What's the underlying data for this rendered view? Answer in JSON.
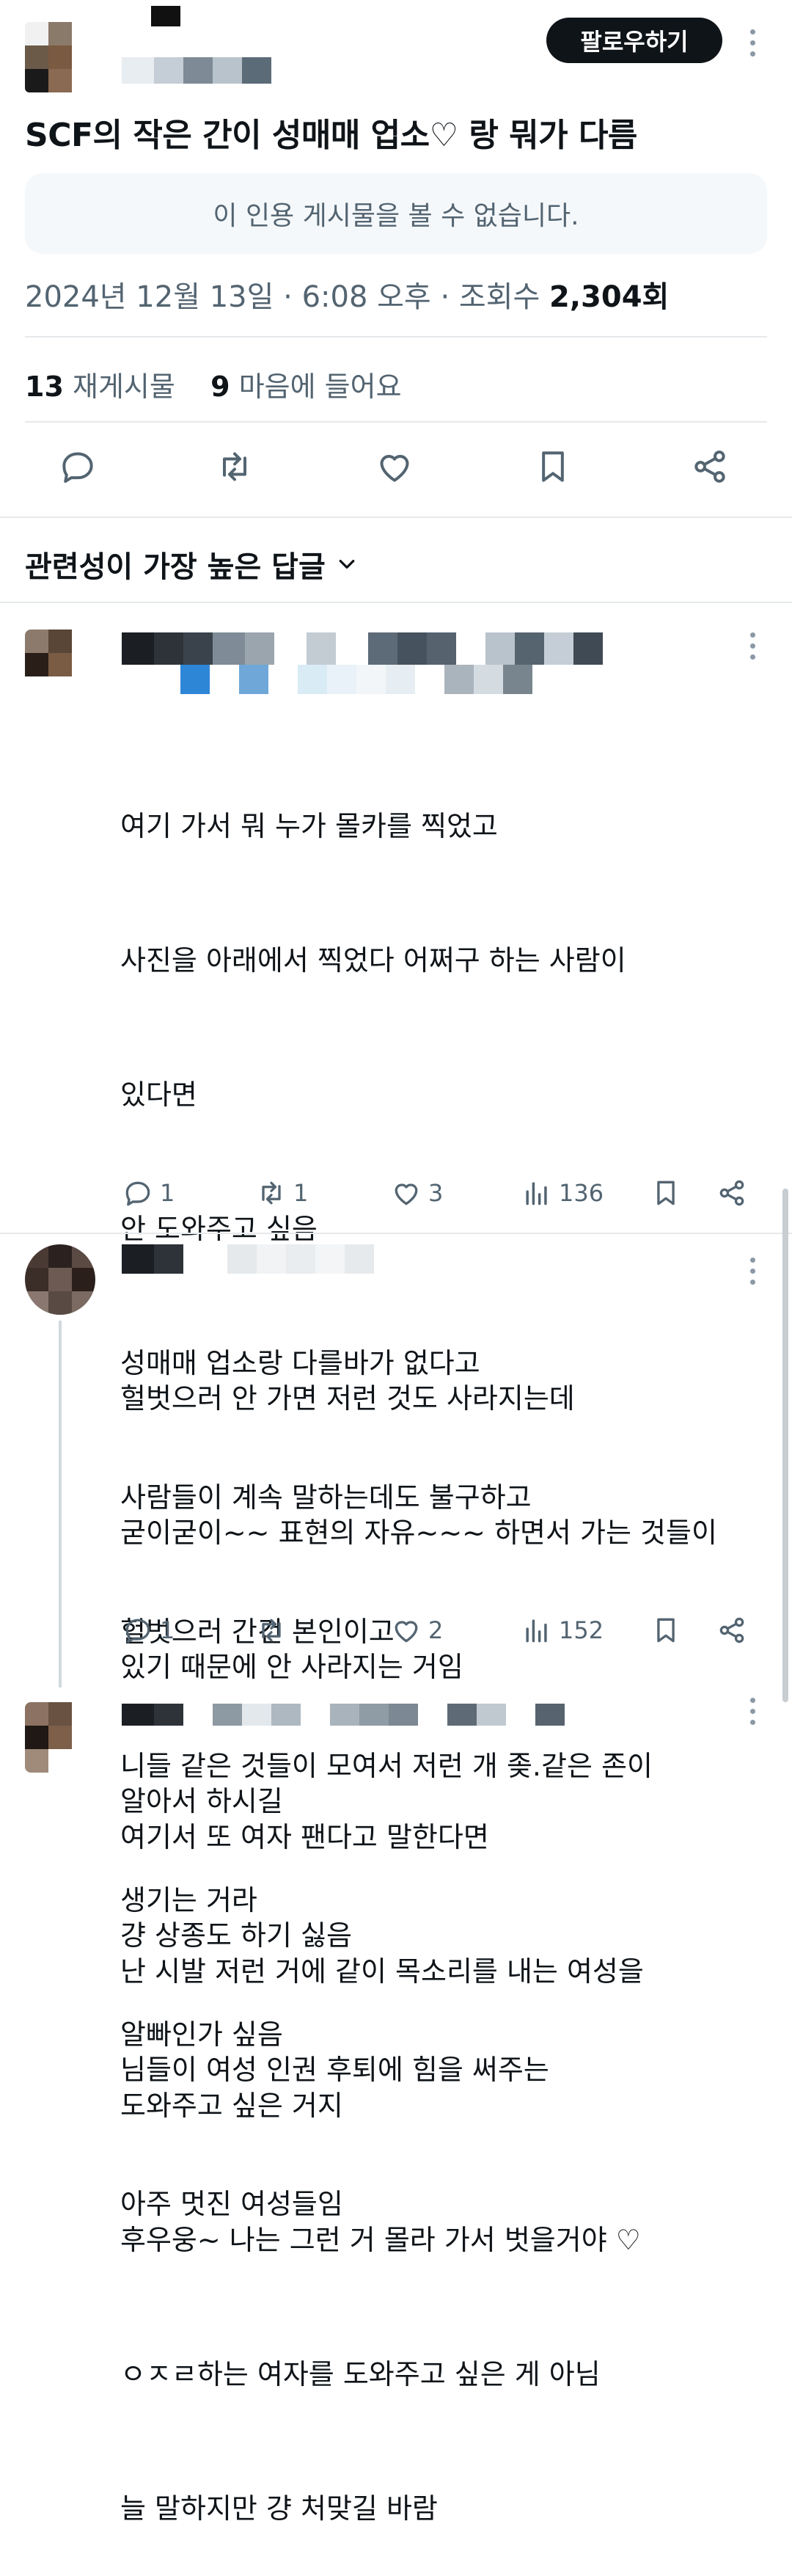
{
  "header": {
    "follow_label": "팔로우하기"
  },
  "post": {
    "title": "SCF의 작은 간이 성매매 업소♡ 랑 뭐가 다름",
    "quote_unavailable": "이 인용 게시물을 볼 수 없습니다.",
    "date": "2024년 12월 13일",
    "time": "6:08 오후",
    "views_label": "조회수",
    "views_count": "2,304회",
    "reposts_count": "13",
    "reposts_label": "재게시물",
    "likes_count": "9",
    "likes_label": "마음에 들어요"
  },
  "replies_section": {
    "sort_label": "관련성이 가장 높은 답글"
  },
  "replies": [
    {
      "lines": [
        "여기 가서 뭐 누가 몰카를 찍었고",
        "사진을 아래에서 찍었다 어쩌구 하는 사람이",
        "있다면",
        "안 도와주고 싶음",
        "성매매 업소랑 다를바가 없다고",
        "사람들이 계속 말하는데도 불구하고",
        "헐벗으러 간건 본인이고",
        "니들 같은 것들이 모여서 저런 개 좆.같은 존이",
        "생기는 거라",
        "알빠인가 싶음"
      ],
      "replies": "1",
      "reposts": "1",
      "likes": "3",
      "views": "136"
    },
    {
      "lines": [
        "헐벗으러 안 가면 저런 것도 사라지는데",
        "굳이굳이~~ 표현의 자유~~~ 하면서 가는 것들이",
        "있기 때문에 안 사라지는 거임",
        "알아서 하시길",
        "걍 상종도 하기 싫음",
        "님들이 여성 인권 후퇴에 힘을 써주는",
        "아주 멋진 여성들임"
      ],
      "replies": "1",
      "reposts": "",
      "likes": "2",
      "views": "152"
    },
    {
      "lines": [
        "여기서 또 여자 팬다고 말한다면",
        "난 시발 저런 거에 같이 목소리를 내는 여성을",
        "도와주고 싶은 거지",
        "후우웅~ 나는 그런 거 몰라 가서 벗을거야 ♡",
        "ㅇㅈㄹ하는 여자를 도와주고 싶은 게 아님",
        "늘 말하지만 걍 처맞길 바람"
      ]
    }
  ],
  "colors": {
    "text_primary": "#0f1419",
    "text_secondary": "#536471",
    "divider": "#e5e9ec"
  }
}
